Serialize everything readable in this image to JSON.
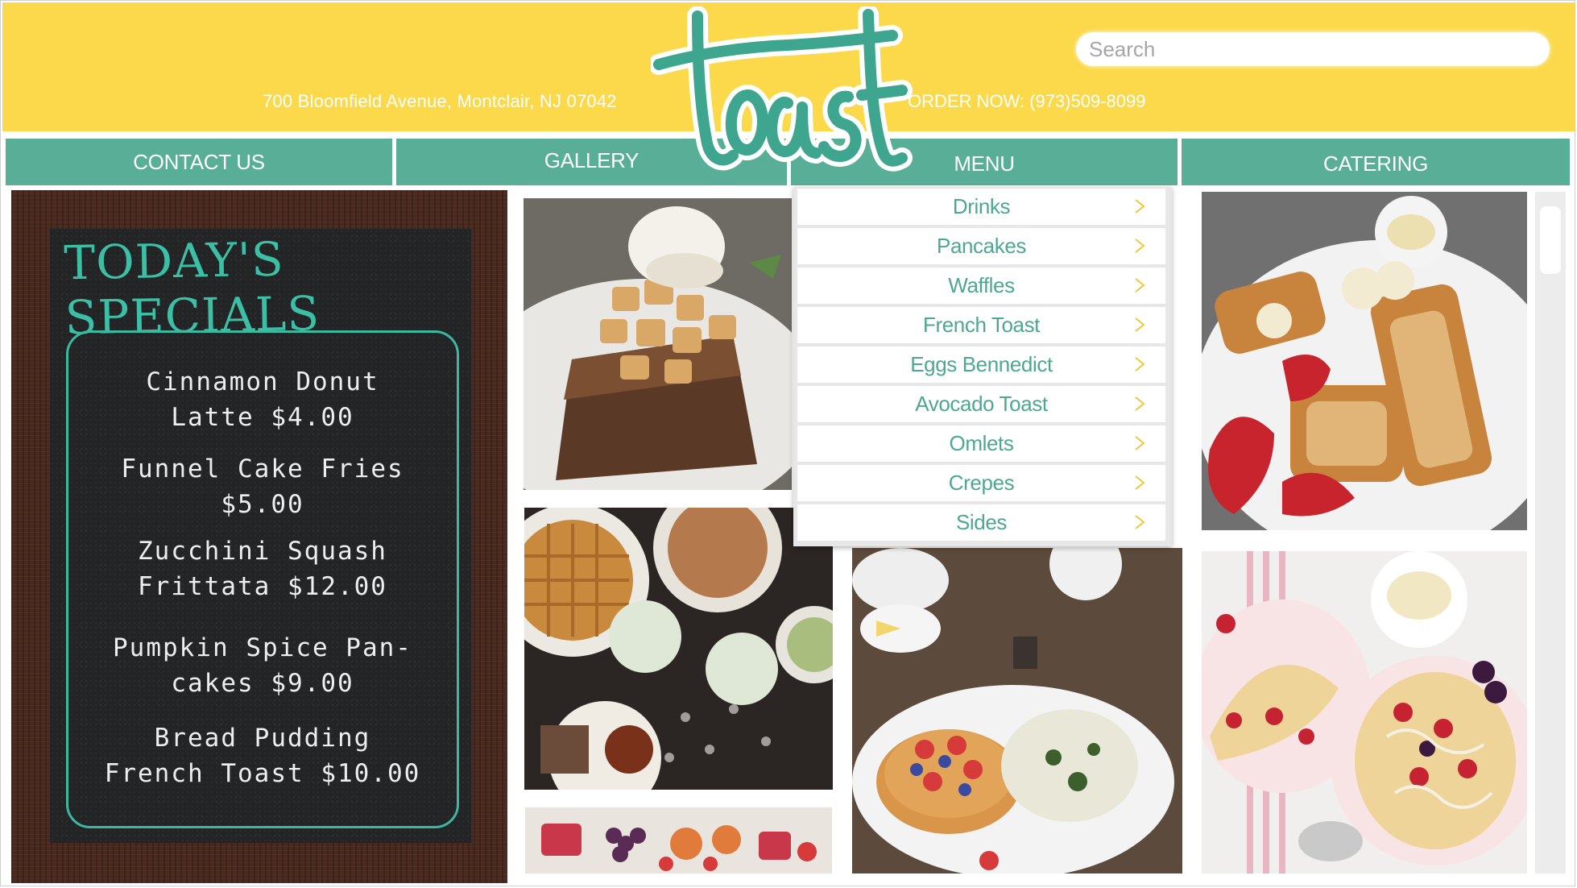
{
  "header": {
    "brand": "toast",
    "address": "700 Bloomfield Avenue, Montclair, NJ 07042",
    "order": "ORDER NOW: (973)509-8099",
    "search_placeholder": "Search",
    "bg_color": "#fbd94a",
    "accent_color": "#58ae96"
  },
  "nav": {
    "items": [
      {
        "label": "CONTACT US"
      },
      {
        "label": "GALLERY"
      },
      {
        "label": "MENU"
      },
      {
        "label": "CATERING"
      }
    ]
  },
  "specials": {
    "title": "TODAY'S SPECIALS",
    "items": [
      {
        "line1": "Cinnamon Donut",
        "line2": "Latte $4.00"
      },
      {
        "line1": "Funnel Cake Fries",
        "line2": "$5.00"
      },
      {
        "line1": "Zucchini Squash",
        "line2": "Frittata $12.00"
      },
      {
        "line1": "Pumpkin Spice Pan-",
        "line2": "cakes $9.00"
      },
      {
        "line1": "Bread Pudding",
        "line2": "French Toast $10.00"
      }
    ]
  },
  "menu_dropdown": {
    "items": [
      {
        "label": "Drinks",
        "icon": "chevron-right-icon"
      },
      {
        "label": "Pancakes",
        "icon": "chevron-right-icon"
      },
      {
        "label": "Waffles",
        "icon": "chevron-right-icon"
      },
      {
        "label": "French Toast",
        "icon": "chevron-right-icon"
      },
      {
        "label": "Eggs Bennedict",
        "icon": "chevron-right-icon"
      },
      {
        "label": "Avocado Toast",
        "icon": "chevron-right-icon"
      },
      {
        "label": "Omlets",
        "icon": "chevron-right-icon"
      },
      {
        "label": "Crepes",
        "icon": "chevron-right-icon"
      },
      {
        "label": "Sides",
        "icon": "chevron-right-icon"
      }
    ]
  },
  "gallery": {
    "photos": [
      {
        "name": "french-toast-ice-cream-photo"
      },
      {
        "name": "waffles-drinks-photo"
      },
      {
        "name": "fruit-platter-photo"
      },
      {
        "name": "pancakes-eggs-photo"
      },
      {
        "name": "french-toast-strawberries-photo"
      },
      {
        "name": "crepes-berries-photo"
      }
    ]
  }
}
